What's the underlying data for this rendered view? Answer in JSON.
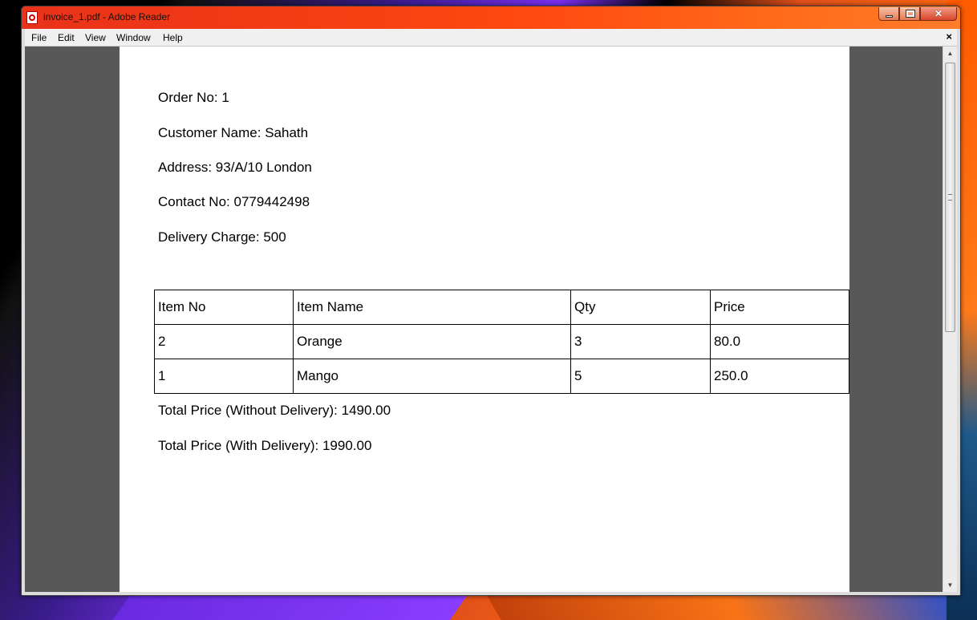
{
  "window": {
    "title": "invoice_1.pdf - Adobe Reader",
    "minimize_glyph": "",
    "close_glyph": "✕"
  },
  "menu": {
    "items": [
      "File",
      "Edit",
      "View",
      "Window",
      "Help"
    ],
    "doc_close": "×"
  },
  "document": {
    "order_no": "Order No: 1",
    "customer_name": "Customer Name: Sahath",
    "address": "Address: 93/A/10 London",
    "contact_no": "Contact No: 0779442498",
    "delivery_charge": "Delivery Charge: 500",
    "table": {
      "headers": [
        "Item No",
        "Item Name",
        "Qty",
        "Price"
      ],
      "rows": [
        [
          "2",
          "Orange",
          "3",
          "80.0"
        ],
        [
          "1",
          "Mango",
          "5",
          "250.0"
        ]
      ]
    },
    "total_without_delivery": "Total Price (Without Delivery): 1490.00",
    "total_with_delivery": "Total Price (With Delivery): 1990.00"
  },
  "scrollbar": {
    "up": "▲",
    "down": "▼"
  }
}
